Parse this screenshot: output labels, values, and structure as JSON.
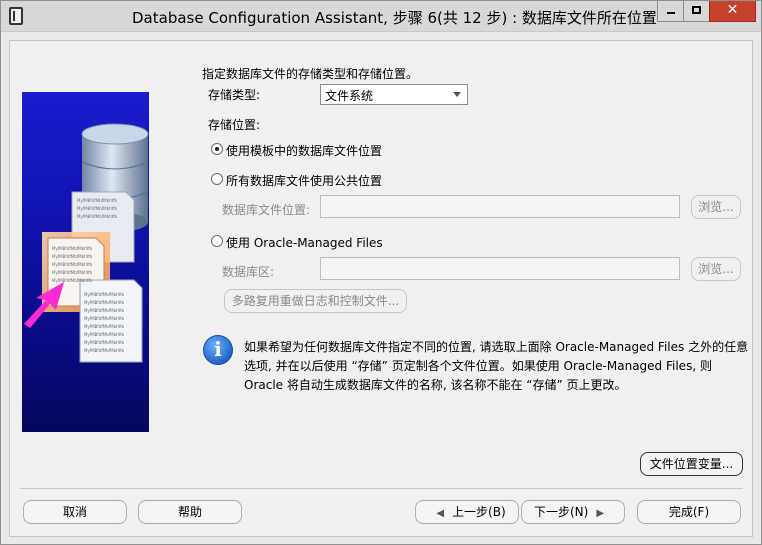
{
  "window": {
    "title": "Database Configuration Assistant, 步骤 6(共 12 步) : 数据库文件所在位置",
    "minimize_label": "—",
    "maximize_label": "☐",
    "close_label": "✕"
  },
  "form": {
    "intro": "指定数据库文件的存储类型和存储位置。",
    "storage_type_label": "存储类型:",
    "storage_type_value": "文件系统",
    "storage_location_label": "存储位置:",
    "radio_template": "使用模板中的数据库文件位置",
    "radio_common": "所有数据库文件使用公共位置",
    "db_file_location_label": "数据库文件位置:",
    "browse1": "浏览...",
    "radio_omf": "使用 Oracle-Managed Files",
    "db_area_label": "数据库区:",
    "browse2": "浏览...",
    "multiplex_button": "多路复用重做日志和控制文件...",
    "info_line1": "如果希望为任何数据库文件指定不同的位置, 请选取上面除 Oracle-Managed Files 之外的任意",
    "info_line2": "选项, 并在以后使用 “存储” 页定制各个文件位置。如果使用 Oracle-Managed Files, 则",
    "info_line3": "Oracle 将自动生成数据库文件的名称, 该名称不能在 “存储” 页上更改。",
    "file_location_vars_button": "文件位置变量..."
  },
  "footer": {
    "cancel": "取消",
    "help": "帮助",
    "back": "上一步(B)",
    "next": "下一步(N)",
    "finish": "完成(F)"
  },
  "illustration": {
    "doc_text": "MyfMBfdfMbfMbfdfb"
  },
  "colors": {
    "side_panel": "#1012b0",
    "close_button": "#c7402b",
    "info_icon": "#1f67c7",
    "arrow": "#ff2bd2"
  }
}
